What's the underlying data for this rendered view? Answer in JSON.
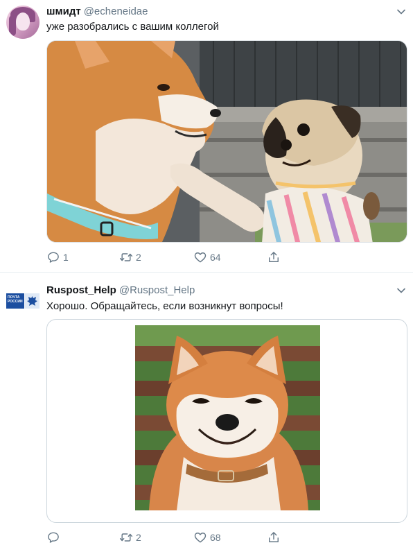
{
  "tweets": [
    {
      "name": "шмидт",
      "handle": "@echeneidae",
      "text": "уже разобрались с вашим коллегой",
      "media_alt": "shiba-inu-and-pug-photo",
      "actions": {
        "replies": "1",
        "retweets": "2",
        "likes": "64"
      }
    },
    {
      "name": "Ruspost_Help",
      "handle": "@Ruspost_Help",
      "text": "Хорошо. Обращайтесь, если возникнут вопросы!",
      "avatar_text": "ПОЧТА РОССИИ",
      "media_alt": "smiling-shiba-inu-photo",
      "actions": {
        "replies": "",
        "retweets": "2",
        "likes": "68"
      }
    }
  ],
  "colors": {
    "text": "#14171a",
    "secondary": "#657786",
    "border": "#e6ecf0",
    "brand_blue": "#1b4ea0"
  },
  "icons": [
    "chevron-down-icon",
    "reply-icon",
    "retweet-icon",
    "like-icon",
    "share-icon"
  ]
}
